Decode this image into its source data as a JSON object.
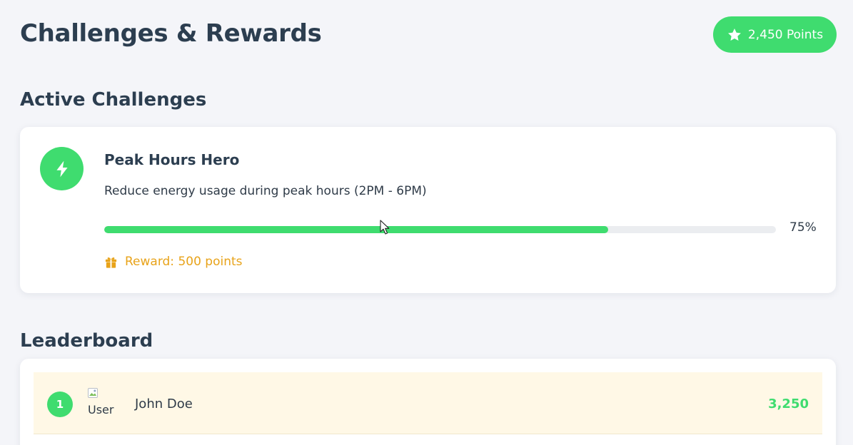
{
  "header": {
    "title": "Challenges & Rewards",
    "points_badge": {
      "icon": "star-icon",
      "label": "2,450 Points"
    }
  },
  "sections": {
    "active": "Active Challenges",
    "leaderboard": "Leaderboard"
  },
  "challenge": {
    "icon": "lightning-icon",
    "title": "Peak Hours Hero",
    "description": "Reduce energy usage during peak hours (2PM - 6PM)",
    "progress": 75,
    "progress_label": "75%",
    "reward_icon": "gift-icon",
    "reward": "Reward: 500 points"
  },
  "leaderboard": [
    {
      "rank": "1",
      "avatar_alt": "User",
      "name": "John Doe",
      "points": "3,250"
    }
  ],
  "colors": {
    "accent": "#3fdc6f",
    "reward": "#e8a31a",
    "highlight_row": "#fff8e6",
    "text": "#2c3e50",
    "background": "#f4f5f9"
  }
}
